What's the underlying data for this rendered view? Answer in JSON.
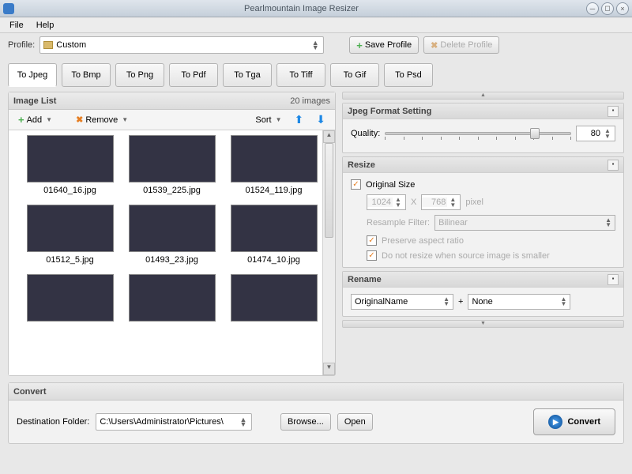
{
  "app": {
    "title": "Pearlmountain Image Resizer"
  },
  "menu": {
    "file": "File",
    "help": "Help"
  },
  "profile": {
    "label": "Profile:",
    "value": "Custom",
    "save": "Save Profile",
    "delete": "Delete Profile"
  },
  "tabs": [
    "To Jpeg",
    "To Bmp",
    "To Png",
    "To Pdf",
    "To Tga",
    "To Tiff",
    "To Gif",
    "To Psd"
  ],
  "image_list": {
    "title": "Image List",
    "count": "20 images",
    "add": "Add",
    "remove": "Remove",
    "sort": "Sort",
    "items": [
      "01640_16.jpg",
      "01539_225.jpg",
      "01524_119.jpg",
      "01512_5.jpg",
      "01493_23.jpg",
      "01474_10.jpg",
      "",
      "",
      ""
    ]
  },
  "jpeg": {
    "title": "Jpeg Format Setting",
    "quality_label": "Quality:",
    "quality_value": "80"
  },
  "resize": {
    "title": "Resize",
    "original": "Original Size",
    "width": "1024",
    "height": "768",
    "x": "X",
    "pixel": "pixel",
    "filter_label": "Resample Filter:",
    "filter_value": "Bilinear",
    "preserve": "Preserve aspect ratio",
    "no_upscale": "Do not resize when source image is smaller"
  },
  "rename": {
    "title": "Rename",
    "part1": "OriginalName",
    "plus": "+",
    "part2": "None"
  },
  "convert": {
    "title": "Convert",
    "dest_label": "Destination Folder:",
    "dest_value": "C:\\Users\\Administrator\\Pictures\\",
    "browse": "Browse...",
    "open": "Open",
    "convert": "Convert"
  }
}
